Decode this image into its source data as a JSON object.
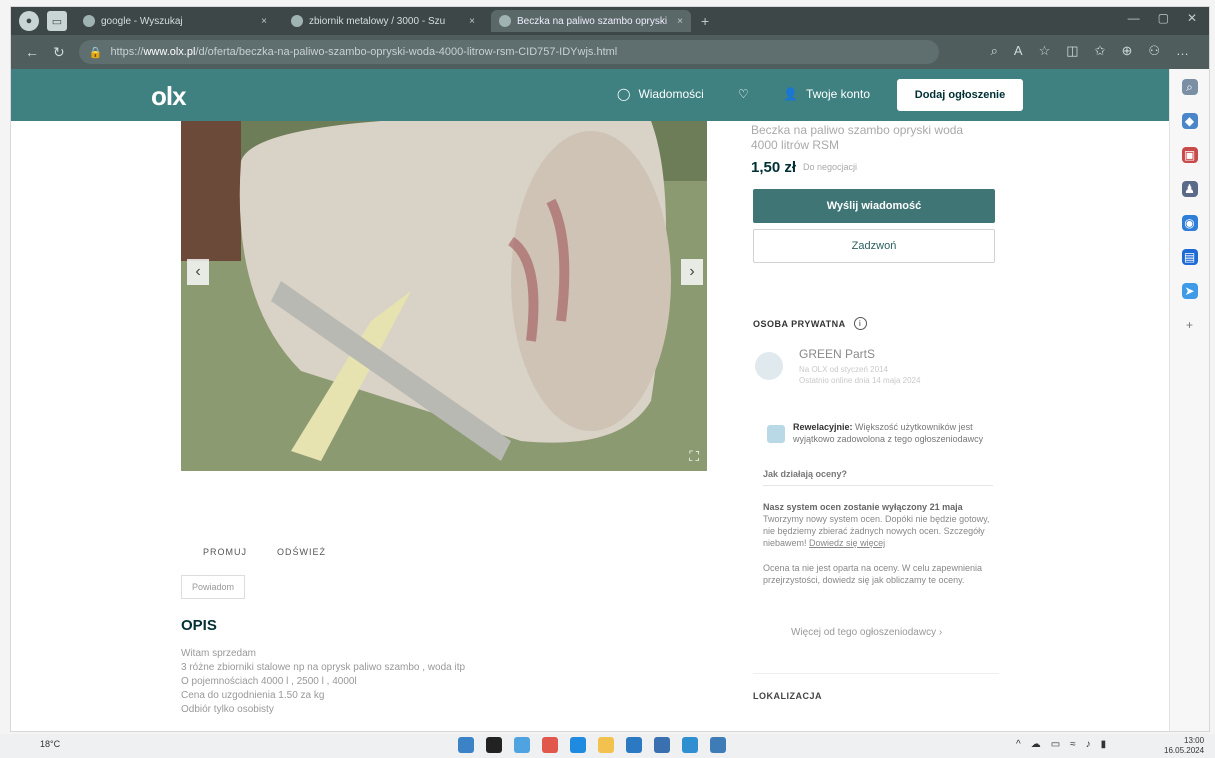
{
  "browser": {
    "tabs": [
      {
        "label": "google - Wyszukaj"
      },
      {
        "label": "zbiornik metalowy / 3000 - Szu"
      },
      {
        "label": "Beczka na paliwo szambo opryski"
      }
    ],
    "new_tab": "+",
    "url_prefix": "https://",
    "url_host": "www.olx.pl",
    "url_path": "/d/oferta/beczka-na-paliwo-szambo-opryski-woda-4000-litrow-rsm-CID757-IDYwjs.html"
  },
  "header": {
    "logo": "olx",
    "messages": "Wiadomości",
    "account": "Twoje konto",
    "add_listing": "Dodaj ogłoszenie"
  },
  "listing": {
    "title": "Beczka na paliwo szambo opryski woda 4000 litrów RSM",
    "price": "1,50 zł",
    "negotiable": "Do negocjacji",
    "send_message": "Wyślij wiadomość",
    "call": "Zadzwoń",
    "promote": "PROMUJ",
    "refresh": "ODŚWIEŻ",
    "similar": "Powiadom"
  },
  "seller": {
    "type_label": "OSOBA PRYWATNA",
    "name": "GREEN PartS",
    "member_since": "Na OLX od styczeń 2014",
    "last_online": "Ostatnio online dnia 14 maja 2024",
    "rating_title": "Rewelacyjnie:",
    "rating_text": "Większość użytkowników jest wyjątkowo zadowolona z tego ogłoszeniodawcy",
    "how_ratings": "Jak działają oceny?",
    "notice_title": "Nasz system ocen zostanie wyłączony 21 maja",
    "notice_text": "Tworzymy nowy system ocen. Dopóki nie będzie gotowy, nie będziemy zbierać żadnych nowych ocen. Szczegóły niebawem!",
    "notice_link": "Dowiedz się więcej",
    "notice2": "Ocena ta nie jest oparta na oceny. W celu zapewnienia przejrzystości, dowiedz się jak obliczamy te oceny.",
    "notice2_link": "sposób obliczamy te oceny",
    "more": "Więcej od tego ogłoszeniodawcy"
  },
  "description": {
    "heading": "OPIS",
    "lines": [
      "Witam sprzedam",
      "3 różne zbiorniki stalowe np na oprysk paliwo szambo , woda itp",
      "O pojemnościach 4000 l , 2500 l , 4000l",
      "Cena do uzgodnienia 1.50 za kg",
      "Odbiór tylko osobisty"
    ]
  },
  "location_label": "LOKALIZACJA",
  "taskbar": {
    "weather": "18°C",
    "time": "13:00",
    "date": "16.05.2024"
  },
  "colors": {
    "olx_teal": "#3f8080",
    "primary_button": "#3f7575"
  }
}
